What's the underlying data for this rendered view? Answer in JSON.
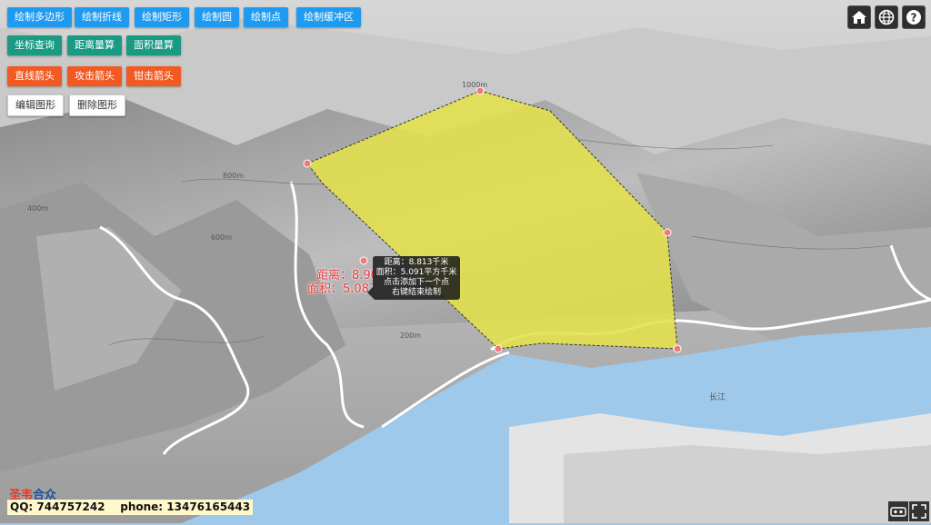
{
  "toolbar": {
    "row1": [
      "绘制多边形",
      "绘制折线",
      "绘制矩形",
      "绘制圆",
      "绘制点",
      "绘制缓冲区"
    ],
    "row2": [
      "坐标查询",
      "距离量算",
      "面积量算"
    ],
    "row3": [
      "直线箭头",
      "攻击箭头",
      "钳击箭头"
    ],
    "row4": [
      "编辑图形",
      "删除图形"
    ]
  },
  "top_right": {
    "icons": [
      "home-icon",
      "globe-icon",
      "help-icon"
    ],
    "help_glyph": "?"
  },
  "tooltip": {
    "lines": [
      "距离：8.813千米",
      "面积：5.091平方千米",
      "点击添加下一个点",
      "右键结束绘制"
    ]
  },
  "measure_label": {
    "distance": "距离：8.90",
    "area": "面积：5.087"
  },
  "footer": {
    "logo_main": "圣韦",
    "logo_sub": "合众",
    "contact": "QQ: 744757242    phone: 13476165443"
  },
  "map_labels": [
    "1000m",
    "800m",
    "600m",
    "400m",
    "200m",
    "长江"
  ],
  "colors": {
    "polygon_fill": "#e3e04a",
    "button_blue": "#1e9bf0",
    "button_teal": "#1a9a82",
    "button_orange": "#f25a22",
    "water": "#9fc9ea",
    "vertex": "#f07a7a"
  }
}
